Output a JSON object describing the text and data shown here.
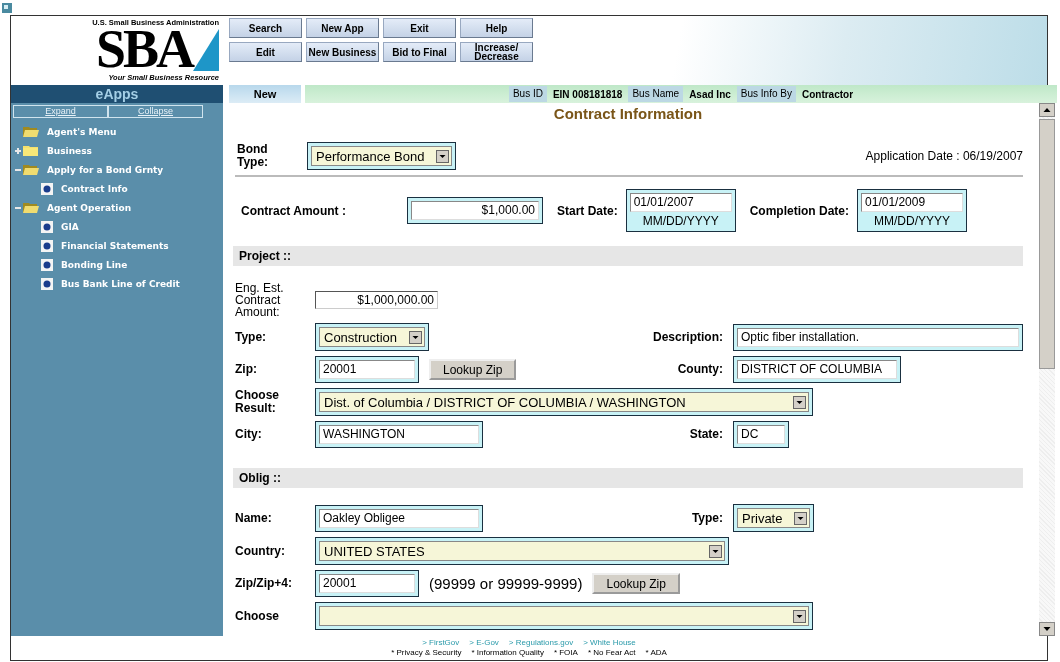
{
  "logo": {
    "agency": "U.S. Small Business Administration",
    "mark": "SBA",
    "tagline": "Your Small Business Resource"
  },
  "toolbar_rows": [
    [
      "Search",
      "New App",
      "Exit",
      "Help"
    ],
    [
      "Edit",
      "New Business",
      "Bid to Final",
      "Increase/ Decrease"
    ]
  ],
  "sidebar": {
    "title": "eApps",
    "links": [
      "Expand",
      "Collapse"
    ],
    "tree": [
      {
        "label": "Agent's Menu",
        "kind": "folder",
        "expanded": true,
        "children": [
          {
            "label": "Business",
            "kind": "folder",
            "expanded": false
          },
          {
            "label": "Apply for a Bond Grnty",
            "kind": "folder",
            "expanded": true,
            "children": [
              {
                "label": "Contract Info",
                "kind": "page"
              }
            ]
          },
          {
            "label": "Agent Operation",
            "kind": "folder",
            "expanded": true,
            "children": [
              {
                "label": "GIA",
                "kind": "page"
              },
              {
                "label": "Financial Statements",
                "kind": "page"
              },
              {
                "label": "Bonding Line",
                "kind": "page"
              },
              {
                "label": "Bus Bank Line of Credit",
                "kind": "page"
              }
            ]
          }
        ]
      }
    ]
  },
  "info_bar": {
    "mode": "New",
    "fields": [
      {
        "label": "Bus ID",
        "value": "EIN 008181818"
      },
      {
        "label": "Bus Name",
        "value": "Asad Inc"
      },
      {
        "label": "Bus Info By",
        "value": "Contractor"
      }
    ]
  },
  "page_title": "Contract Information",
  "bond": {
    "label": "Bond Type:",
    "value": "Performance Bond",
    "application_date": "Application Date : 06/19/2007"
  },
  "contract": {
    "amount_label": "Contract Amount :",
    "amount": "$1,000.00",
    "start_label": "Start Date:",
    "start": "01/01/2007",
    "start_hint": "MM/DD/YYYY",
    "completion_label": "Completion Date:",
    "completion": "01/01/2009",
    "completion_hint": "MM/DD/YYYY"
  },
  "sections": [
    {
      "heading": "Project ::",
      "rows": [
        {
          "label": "Eng. Est. Contract Amount:",
          "kind": "amount",
          "value": "$1,000,000.00"
        },
        {
          "label": "Type:",
          "kind": "select",
          "value": "Construction",
          "right": {
            "label": "Description:",
            "kind": "long-text",
            "value": "Optic fiber installation."
          }
        },
        {
          "label": "Zip:",
          "kind": "zip-text",
          "value": "20001",
          "button": "Lookup Zip",
          "right": {
            "label": "County:",
            "kind": "text",
            "value": "DISTRICT OF COLUMBIA"
          }
        },
        {
          "label": "Choose Result:",
          "kind": "wide-select",
          "value": "Dist. of Columbia / DISTRICT OF COLUMBIA / WASHINGTON"
        },
        {
          "label": "City:",
          "kind": "text",
          "value": "WASHINGTON",
          "right": {
            "label": "State:",
            "kind": "short-text",
            "value": "DC"
          }
        }
      ]
    },
    {
      "heading": "Oblig ::",
      "rows": [
        {
          "label": "Name:",
          "kind": "text",
          "value": "Oakley Obligee",
          "right": {
            "label": "Type:",
            "kind": "select",
            "value": "Private"
          }
        },
        {
          "label": "Country:",
          "kind": "long-select",
          "value": "UNITED STATES"
        },
        {
          "label": "Zip/Zip+4:",
          "kind": "zip-text",
          "value": "20001",
          "note": "(99999 or 99999-9999)",
          "button": "Lookup Zip"
        },
        {
          "label": "Choose",
          "kind": "wide-select"
        }
      ]
    }
  ],
  "footer": {
    "links": [
      "> FirstGov",
      "> E-Gov",
      "> Regulations.gov",
      "> White House"
    ],
    "notes": [
      "* Privacy & Security",
      "* Information Quality",
      "* FOIA",
      "* No Fear Act",
      "* ADA"
    ]
  }
}
